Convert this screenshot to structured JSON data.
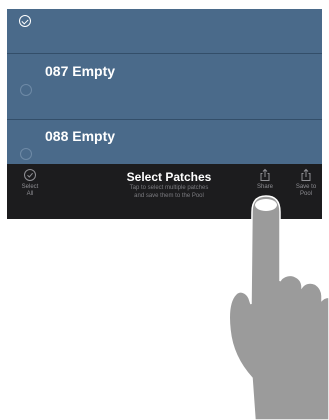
{
  "list": {
    "items": [
      {
        "label": "",
        "selected": true
      },
      {
        "label": "087 Empty",
        "selected": false
      },
      {
        "label": "088 Empty",
        "selected": false
      }
    ]
  },
  "toolbar": {
    "select_all_line1": "Select",
    "select_all_line2": "All",
    "title": "Select Patches",
    "subtitle_line1": "Tap to select multiple patches",
    "subtitle_line2": "and save them to the Pool",
    "share_label": "Share",
    "save_line1": "Save to",
    "save_line2": "Pool"
  },
  "colors": {
    "list_bg": "#4a6a8a",
    "toolbar_bg": "#1c1c1e",
    "hand": "#9b9b9b"
  }
}
